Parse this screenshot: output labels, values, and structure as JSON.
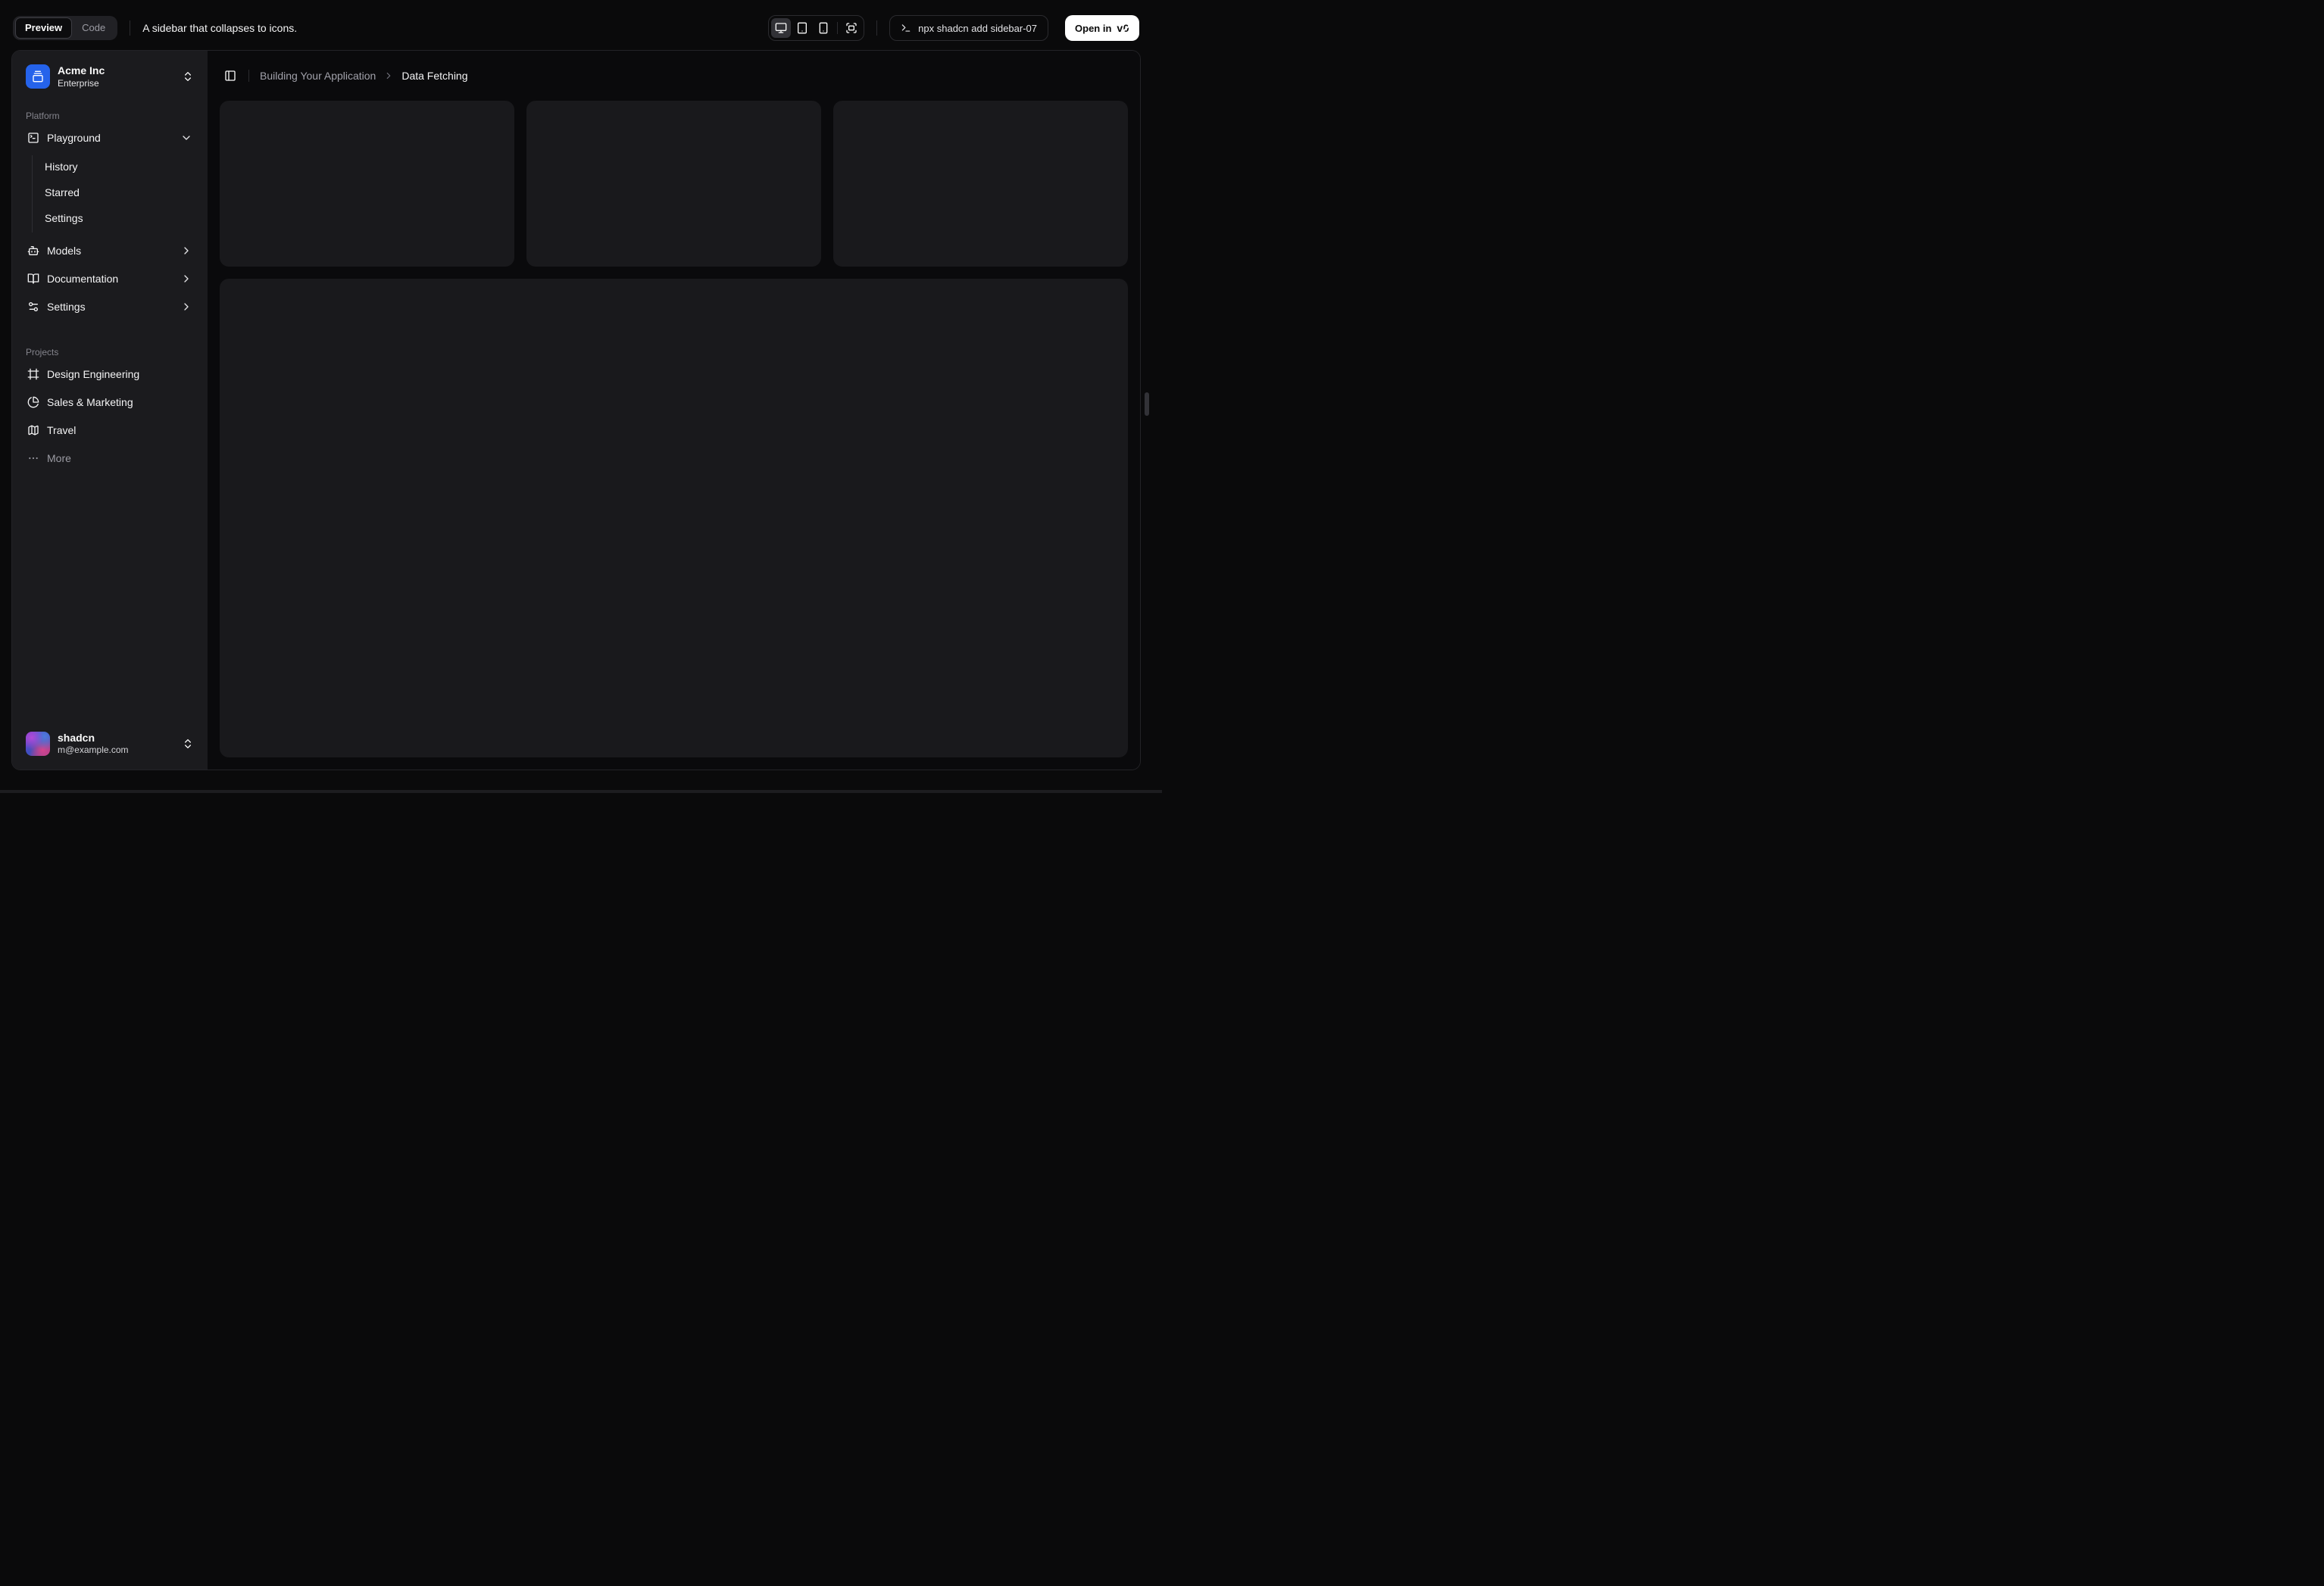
{
  "toolbar": {
    "preview_label": "Preview",
    "code_label": "Code",
    "description": "A sidebar that collapses to icons.",
    "device_icons": [
      "desktop-icon",
      "tablet-icon",
      "phone-icon",
      "fullscreen-icon"
    ],
    "active_device": "desktop",
    "command": "npx shadcn add sidebar-07",
    "open_in_label": "Open in",
    "open_in_logo_v": "v",
    "open_in_logo_zero": "0"
  },
  "sidebar": {
    "team": {
      "name": "Acme Inc",
      "plan": "Enterprise",
      "icon": "gallery-vertical-end-icon",
      "logo_color": "#2563eb"
    },
    "groups": [
      {
        "label": "Platform",
        "items": [
          {
            "label": "Playground",
            "icon": "square-terminal-icon",
            "expanded": true,
            "children": [
              "History",
              "Starred",
              "Settings"
            ]
          },
          {
            "label": "Models",
            "icon": "bot-icon"
          },
          {
            "label": "Documentation",
            "icon": "book-open-icon"
          },
          {
            "label": "Settings",
            "icon": "settings-icon"
          }
        ]
      },
      {
        "label": "Projects",
        "items": [
          {
            "label": "Design Engineering",
            "icon": "frame-icon"
          },
          {
            "label": "Sales & Marketing",
            "icon": "pie-chart-icon"
          },
          {
            "label": "Travel",
            "icon": "map-icon"
          },
          {
            "label": "More",
            "icon": "ellipsis-icon",
            "muted": true
          }
        ]
      }
    ],
    "user": {
      "name": "shadcn",
      "email": "m@example.com"
    }
  },
  "main": {
    "breadcrumb": {
      "parent": "Building Your Application",
      "current": "Data Fetching"
    },
    "placeholder_cards": 3
  },
  "colors": {
    "page_bg": "#0a0a0b",
    "sidebar_bg": "#1b1b1e",
    "card_bg": "#19191c",
    "border": "#232327",
    "accent_blue": "#2563eb",
    "muted_text": "#a1a1aa"
  }
}
